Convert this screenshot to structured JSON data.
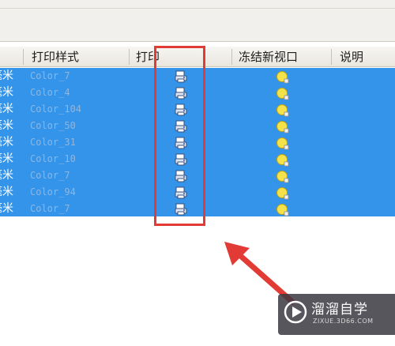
{
  "header": {
    "col_plot_style": "打印样式",
    "col_plot": "打印",
    "col_freeze": "冻结新视口",
    "col_description": "说明"
  },
  "rows": [
    {
      "unit": "毫米",
      "plot_style": "Color_7"
    },
    {
      "unit": "毫米",
      "plot_style": "Color_4"
    },
    {
      "unit": "毫米",
      "plot_style": "Color_104"
    },
    {
      "unit": "毫米",
      "plot_style": "Color_50"
    },
    {
      "unit": "毫米",
      "plot_style": "Color_31"
    },
    {
      "unit": "毫米",
      "plot_style": "Color_10"
    },
    {
      "unit": "毫米",
      "plot_style": "Color_7"
    },
    {
      "unit": "毫米",
      "plot_style": "Color_94"
    },
    {
      "unit": "毫米",
      "plot_style": "Color_7"
    }
  ],
  "icons": {
    "plot": "printer-icon",
    "freeze": "sun-icon"
  },
  "colors": {
    "selection": "#3394ea",
    "highlight": "#e23b35"
  },
  "watermark": {
    "title": "溜溜自学",
    "url": "ZIXUE.3D66.COM"
  }
}
